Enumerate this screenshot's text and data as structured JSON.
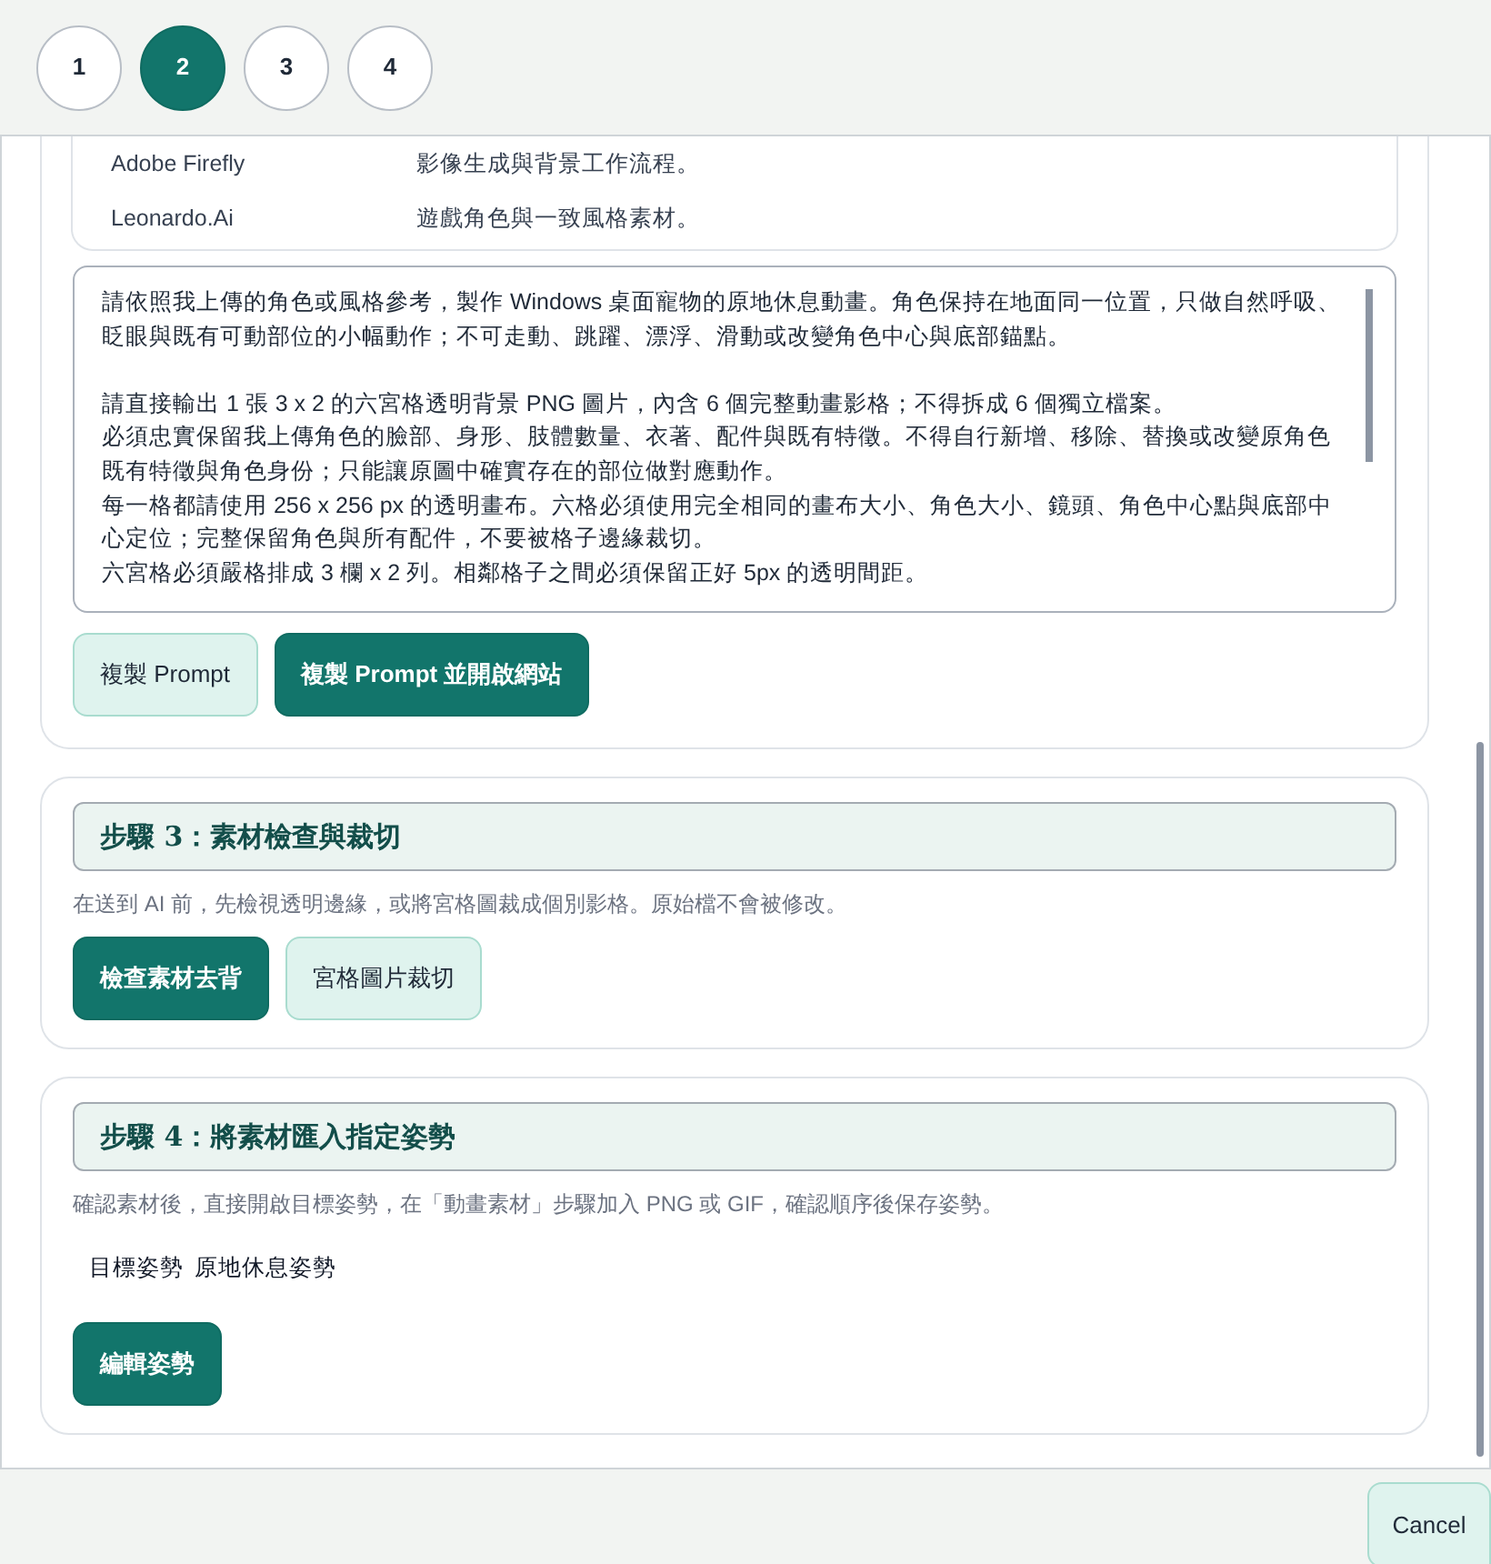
{
  "stepper": [
    {
      "label": "1",
      "selected": false
    },
    {
      "label": "2",
      "selected": true
    },
    {
      "label": "3",
      "selected": false
    },
    {
      "label": "4",
      "selected": false
    }
  ],
  "tools_table": {
    "rows": [
      {
        "name": "Adobe Firefly",
        "use": "影像生成與背景工作流程。"
      },
      {
        "name": "Leonardo.Ai",
        "use": "遊戲角色與一致風格素材。"
      }
    ]
  },
  "prompt_box": {
    "paragraphs": [
      {
        "lines": [
          "請依照我上傳的角色或風格參考，製作 Windows 桌面寵物的原地休息動畫。角色保持在地面同一位置，只做自然呼吸、眨眼與既有可動部位的小幅動作；不可走動、跳躍、漂浮、滑動或改變角色中心與底部錨點。"
        ]
      },
      {
        "lines": [
          "請直接輸出 1 張 3 x 2 的六宮格透明背景 PNG 圖片，內含 6 個完整動畫影格；不得拆成 6 個獨立檔案。",
          "必須忠實保留我上傳角色的臉部、身形、肢體數量、衣著、配件與既有特徵。不得自行新增、移除、替換或改變原角色既有特徵與角色身份；只能讓原圖中確實存在的部位做對應動作。",
          "每一格都請使用 256 x 256 px 的透明畫布。六格必須使用完全相同的畫布大小、角色大小、鏡頭、角色中心點與底部中心定位；完整保留角色與所有配件，不要被格子邊緣裁切。",
          "六宮格必須嚴格排成 3 欄 x 2 列。相鄰格子之間必須保留正好 5px 的透明間距。"
        ]
      }
    ]
  },
  "prompt_buttons": [
    {
      "label": "複製 Prompt",
      "kind": "secondary"
    },
    {
      "label": "複製 Prompt 並開啟網站",
      "kind": "primary"
    }
  ],
  "steps": [
    {
      "title": "步驟 3：素材檢查與裁切",
      "description": "在送到 AI 前，先檢視透明邊緣，或將宮格圖裁成個別影格。原始檔不會被修改。",
      "buttons": [
        {
          "label": "檢查素材去背",
          "kind": "primary"
        },
        {
          "label": "宮格圖片裁切",
          "kind": "secondary"
        }
      ]
    },
    {
      "title": "步驟 4：將素材匯入指定姿勢",
      "description": "確認素材後，直接開啟目標姿勢，在「動畫素材」步驟加入 PNG 或 GIF，確認順序後保存姿勢。",
      "target": {
        "label": "目標姿勢",
        "value": "原地休息姿勢"
      },
      "buttons": [
        {
          "label": "編輯姿勢",
          "kind": "primary"
        }
      ]
    }
  ],
  "footer": {
    "cancel_button": "Cancel"
  }
}
